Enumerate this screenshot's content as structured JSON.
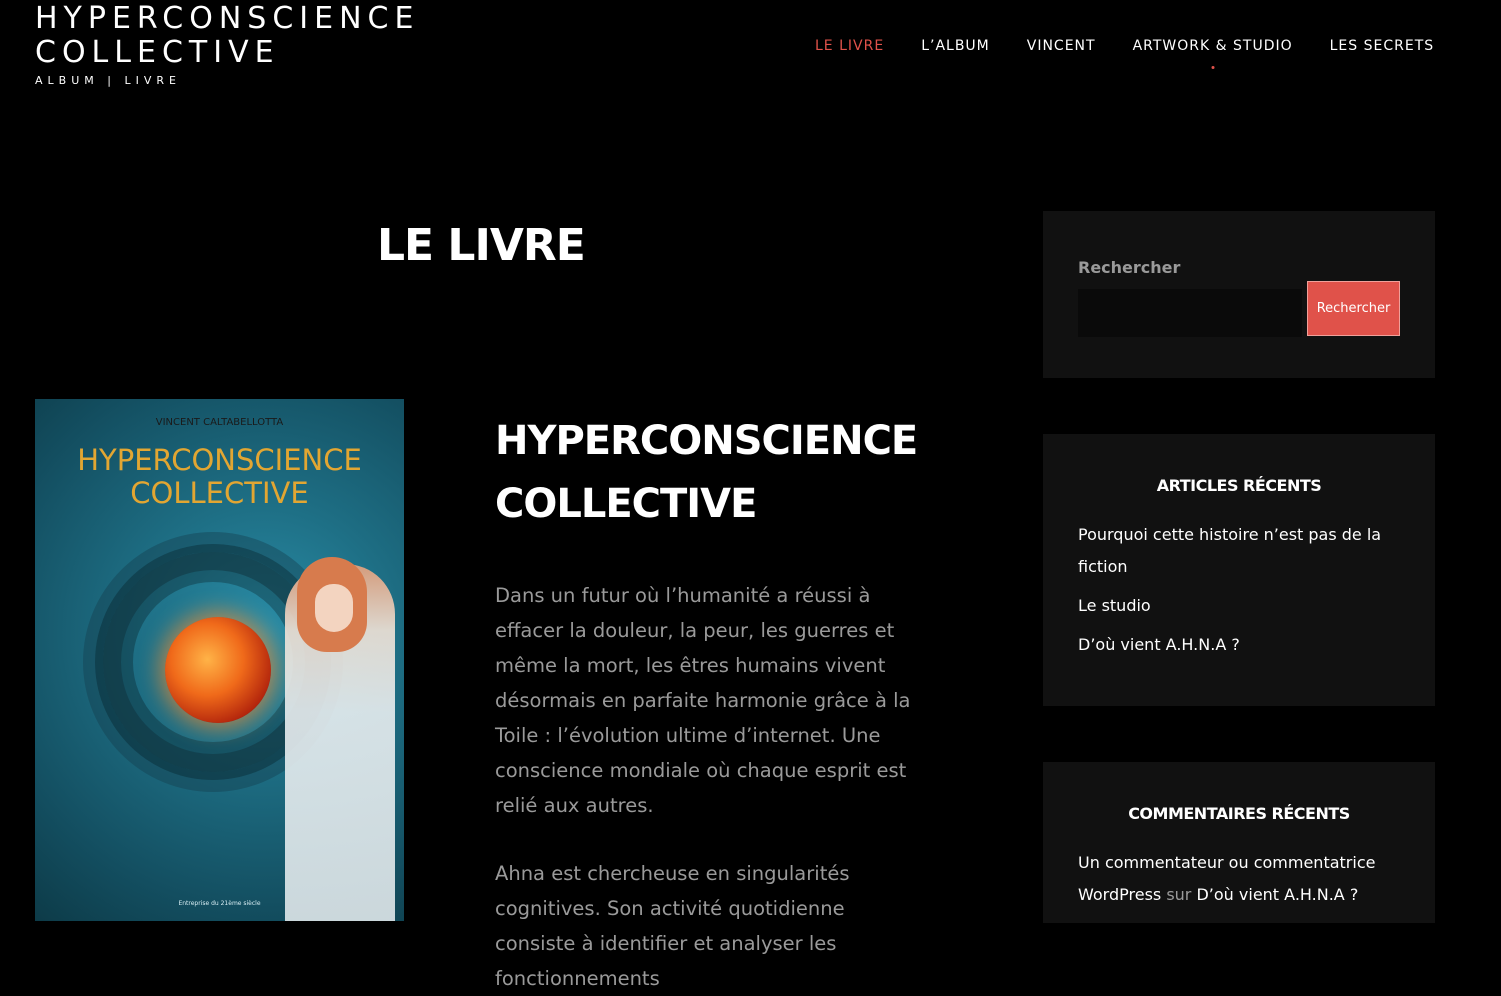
{
  "site": {
    "title": "HYPERCONSCIENCE\nCOLLECTIVE",
    "subtitle": "ALBUM | LIVRE"
  },
  "nav": {
    "items": [
      {
        "label": "LE LIVRE"
      },
      {
        "label": "L’ALBUM"
      },
      {
        "label": "VINCENT"
      },
      {
        "label": "ARTWORK & STUDIO"
      },
      {
        "label": "LES SECRETS"
      }
    ],
    "active_index": 0,
    "accent_color": "#e0524a"
  },
  "page": {
    "title": "LE LIVRE"
  },
  "book": {
    "cover": {
      "author": "VINCENT CALTABELLOTTA",
      "title": "HYPERCONSCIENCE\nCOLLECTIVE",
      "tagline": "Entreprise du 21ème siècle"
    },
    "title": "HYPERCONSCIENCE\nCOLLECTIVE",
    "paragraphs": [
      "Dans un futur où l’humanité a réussi à effacer la douleur, la peur, les guerres et même la mort, les êtres humains vivent désormais en parfaite harmonie grâce à la Toile : l’évolution ultime d’internet. Une conscience mondiale où chaque esprit est relié aux autres.",
      "Ahna est chercheuse en singularités cognitives. Son activité quotidienne consiste à identifier et analyser les fonctionnements"
    ]
  },
  "sidebar": {
    "search": {
      "label": "Rechercher",
      "placeholder": "",
      "button_label": "Rechercher"
    },
    "recent_posts": {
      "heading": "ARTICLES RÉCENTS",
      "items": [
        "Pourquoi cette histoire n’est pas de la fiction",
        "Le studio",
        "D’où vient A.H.N.A ?"
      ]
    },
    "recent_comments": {
      "heading": "COMMENTAIRES RÉCENTS",
      "items": [
        {
          "author": "Un commentateur ou commentatrice WordPress",
          "sep": "sur",
          "post": "D’où vient A.H.N.A ?"
        }
      ]
    }
  }
}
